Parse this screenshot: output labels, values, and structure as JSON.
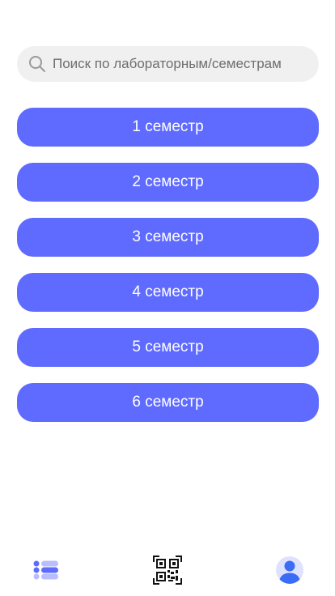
{
  "search": {
    "placeholder": "Поиск по лабораторным/семестрам",
    "icon": "search-icon"
  },
  "semesters": [
    {
      "label": "1 семестр"
    },
    {
      "label": "2 семестр"
    },
    {
      "label": "3 семестр"
    },
    {
      "label": "4 семестр"
    },
    {
      "label": "5 семестр"
    },
    {
      "label": "6 семестр"
    }
  ],
  "bottom_nav": {
    "items": [
      {
        "icon": "list-icon"
      },
      {
        "icon": "qr-code-icon"
      },
      {
        "icon": "profile-icon"
      }
    ]
  },
  "colors": {
    "accent": "#5f6bff",
    "search_bg": "#f0f0f0",
    "placeholder_text": "#6e6e6e",
    "nav_list_icon": "#5f6bff",
    "nav_list_icon_light": "#b8bdff",
    "nav_profile_bg": "#dfe2ff",
    "nav_profile_fg": "#3a6cf5"
  }
}
